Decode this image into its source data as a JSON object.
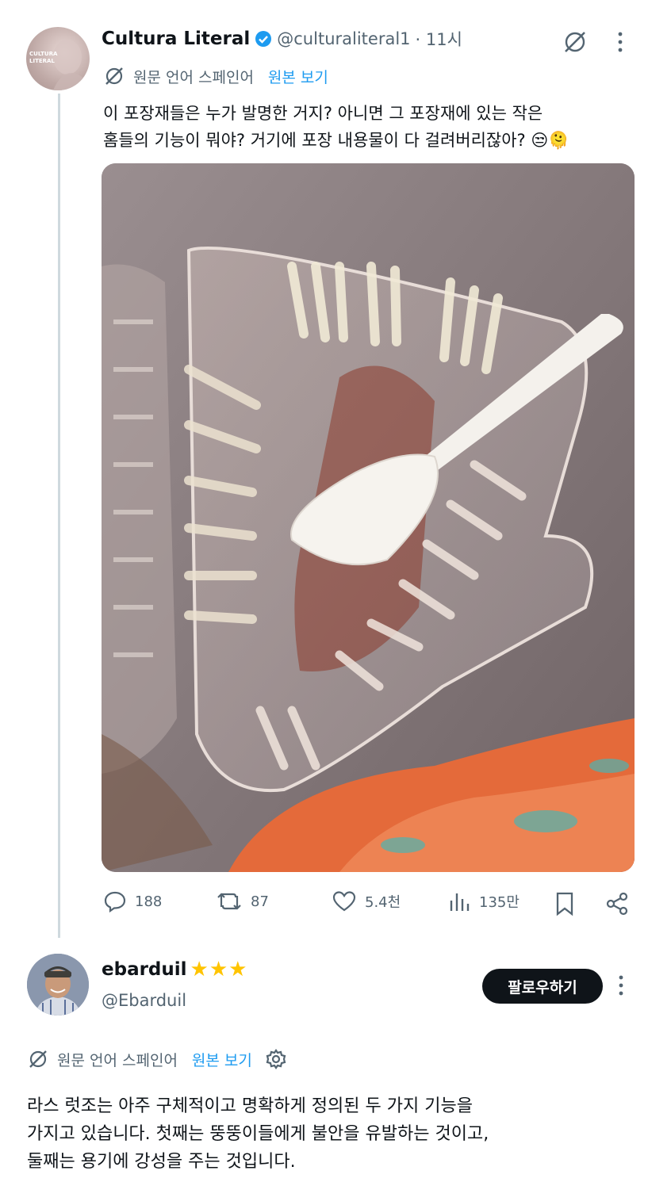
{
  "post": {
    "author_name": "Cultura Literal",
    "author_handle": "@culturaliteral1",
    "time": " · 11시",
    "avatar_text_line1": "CULTURA",
    "avatar_text_line2": "LITERAL",
    "translated_from": "원문 언어 스페인어",
    "view_original": "원본 보기",
    "text_line1": "이 포장재들은 누가 발명한 거지? 아니면 그 포장재에 있는 작은",
    "text_line2": "홈들의 기능이 뭐야? 거기에 포장 내용물이 다 걸려버리잖아? 😒🫠",
    "stats": {
      "replies": "188",
      "reposts": "87",
      "likes": "5.4천",
      "views": "135만"
    }
  },
  "reply": {
    "author_name": "ebarduil",
    "stars": "★★★",
    "author_handle": "@Ebarduil",
    "follow_label": "팔로우하기",
    "translated_from": "원문 언어 스페인어",
    "view_original": "원본 보기",
    "text_line1": "라스 럿조는 아주 구체적이고 명확하게 정의된 두 가지 기능을",
    "text_line2": "가지고 있습니다. 첫째는 뚱뚱이들에게 불안을 유발하는 것이고,",
    "text_line3": "둘째는 용기에 강성을 주는 것입니다."
  },
  "colors": {
    "accent": "#1d9bf0",
    "verified": "#1d9bf0",
    "star": "#ffc400"
  },
  "icons": [
    "no-translate-icon",
    "more-icon",
    "verified-badge-icon",
    "reply-icon",
    "repost-icon",
    "like-icon",
    "views-icon",
    "bookmark-icon",
    "share-icon",
    "gear-icon"
  ]
}
